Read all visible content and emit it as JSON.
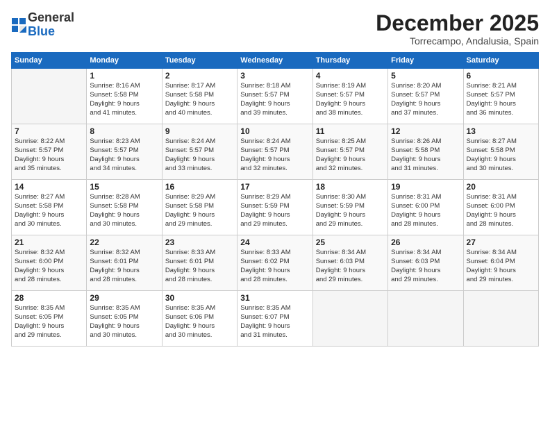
{
  "logo": {
    "general": "General",
    "blue": "Blue"
  },
  "header": {
    "month": "December 2025",
    "location": "Torrecampo, Andalusia, Spain"
  },
  "weekdays": [
    "Sunday",
    "Monday",
    "Tuesday",
    "Wednesday",
    "Thursday",
    "Friday",
    "Saturday"
  ],
  "weeks": [
    [
      {
        "day": "",
        "info": ""
      },
      {
        "day": "1",
        "info": "Sunrise: 8:16 AM\nSunset: 5:58 PM\nDaylight: 9 hours\nand 41 minutes."
      },
      {
        "day": "2",
        "info": "Sunrise: 8:17 AM\nSunset: 5:58 PM\nDaylight: 9 hours\nand 40 minutes."
      },
      {
        "day": "3",
        "info": "Sunrise: 8:18 AM\nSunset: 5:57 PM\nDaylight: 9 hours\nand 39 minutes."
      },
      {
        "day": "4",
        "info": "Sunrise: 8:19 AM\nSunset: 5:57 PM\nDaylight: 9 hours\nand 38 minutes."
      },
      {
        "day": "5",
        "info": "Sunrise: 8:20 AM\nSunset: 5:57 PM\nDaylight: 9 hours\nand 37 minutes."
      },
      {
        "day": "6",
        "info": "Sunrise: 8:21 AM\nSunset: 5:57 PM\nDaylight: 9 hours\nand 36 minutes."
      }
    ],
    [
      {
        "day": "7",
        "info": "Sunrise: 8:22 AM\nSunset: 5:57 PM\nDaylight: 9 hours\nand 35 minutes."
      },
      {
        "day": "8",
        "info": "Sunrise: 8:23 AM\nSunset: 5:57 PM\nDaylight: 9 hours\nand 34 minutes."
      },
      {
        "day": "9",
        "info": "Sunrise: 8:24 AM\nSunset: 5:57 PM\nDaylight: 9 hours\nand 33 minutes."
      },
      {
        "day": "10",
        "info": "Sunrise: 8:24 AM\nSunset: 5:57 PM\nDaylight: 9 hours\nand 32 minutes."
      },
      {
        "day": "11",
        "info": "Sunrise: 8:25 AM\nSunset: 5:57 PM\nDaylight: 9 hours\nand 32 minutes."
      },
      {
        "day": "12",
        "info": "Sunrise: 8:26 AM\nSunset: 5:58 PM\nDaylight: 9 hours\nand 31 minutes."
      },
      {
        "day": "13",
        "info": "Sunrise: 8:27 AM\nSunset: 5:58 PM\nDaylight: 9 hours\nand 30 minutes."
      }
    ],
    [
      {
        "day": "14",
        "info": "Sunrise: 8:27 AM\nSunset: 5:58 PM\nDaylight: 9 hours\nand 30 minutes."
      },
      {
        "day": "15",
        "info": "Sunrise: 8:28 AM\nSunset: 5:58 PM\nDaylight: 9 hours\nand 30 minutes."
      },
      {
        "day": "16",
        "info": "Sunrise: 8:29 AM\nSunset: 5:58 PM\nDaylight: 9 hours\nand 29 minutes."
      },
      {
        "day": "17",
        "info": "Sunrise: 8:29 AM\nSunset: 5:59 PM\nDaylight: 9 hours\nand 29 minutes."
      },
      {
        "day": "18",
        "info": "Sunrise: 8:30 AM\nSunset: 5:59 PM\nDaylight: 9 hours\nand 29 minutes."
      },
      {
        "day": "19",
        "info": "Sunrise: 8:31 AM\nSunset: 6:00 PM\nDaylight: 9 hours\nand 28 minutes."
      },
      {
        "day": "20",
        "info": "Sunrise: 8:31 AM\nSunset: 6:00 PM\nDaylight: 9 hours\nand 28 minutes."
      }
    ],
    [
      {
        "day": "21",
        "info": "Sunrise: 8:32 AM\nSunset: 6:00 PM\nDaylight: 9 hours\nand 28 minutes."
      },
      {
        "day": "22",
        "info": "Sunrise: 8:32 AM\nSunset: 6:01 PM\nDaylight: 9 hours\nand 28 minutes."
      },
      {
        "day": "23",
        "info": "Sunrise: 8:33 AM\nSunset: 6:01 PM\nDaylight: 9 hours\nand 28 minutes."
      },
      {
        "day": "24",
        "info": "Sunrise: 8:33 AM\nSunset: 6:02 PM\nDaylight: 9 hours\nand 28 minutes."
      },
      {
        "day": "25",
        "info": "Sunrise: 8:34 AM\nSunset: 6:03 PM\nDaylight: 9 hours\nand 29 minutes."
      },
      {
        "day": "26",
        "info": "Sunrise: 8:34 AM\nSunset: 6:03 PM\nDaylight: 9 hours\nand 29 minutes."
      },
      {
        "day": "27",
        "info": "Sunrise: 8:34 AM\nSunset: 6:04 PM\nDaylight: 9 hours\nand 29 minutes."
      }
    ],
    [
      {
        "day": "28",
        "info": "Sunrise: 8:35 AM\nSunset: 6:05 PM\nDaylight: 9 hours\nand 29 minutes."
      },
      {
        "day": "29",
        "info": "Sunrise: 8:35 AM\nSunset: 6:05 PM\nDaylight: 9 hours\nand 30 minutes."
      },
      {
        "day": "30",
        "info": "Sunrise: 8:35 AM\nSunset: 6:06 PM\nDaylight: 9 hours\nand 30 minutes."
      },
      {
        "day": "31",
        "info": "Sunrise: 8:35 AM\nSunset: 6:07 PM\nDaylight: 9 hours\nand 31 minutes."
      },
      {
        "day": "",
        "info": ""
      },
      {
        "day": "",
        "info": ""
      },
      {
        "day": "",
        "info": ""
      }
    ]
  ]
}
